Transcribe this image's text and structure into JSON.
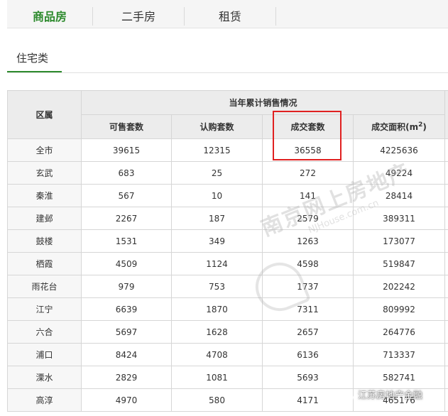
{
  "tabs": {
    "items": [
      {
        "label": "商品房",
        "active": true
      },
      {
        "label": "二手房",
        "active": false
      },
      {
        "label": "租赁",
        "active": false
      }
    ]
  },
  "subtab": {
    "label": "住宅类"
  },
  "table": {
    "district_header": "区属",
    "group_header": "当年累计销售情况",
    "columns": [
      "可售套数",
      "认购套数",
      "成交套数",
      "成交面积(m",
      "2",
      ")"
    ],
    "rows": [
      {
        "district": "全市",
        "available": "39615",
        "subscribed": "12315",
        "deals": "36558",
        "area": "4225636"
      },
      {
        "district": "玄武",
        "available": "683",
        "subscribed": "25",
        "deals": "272",
        "area": "49224"
      },
      {
        "district": "秦淮",
        "available": "567",
        "subscribed": "10",
        "deals": "141",
        "area": "28414"
      },
      {
        "district": "建邺",
        "available": "2267",
        "subscribed": "187",
        "deals": "2579",
        "area": "389311"
      },
      {
        "district": "鼓楼",
        "available": "1531",
        "subscribed": "349",
        "deals": "1263",
        "area": "173077"
      },
      {
        "district": "栖霞",
        "available": "4509",
        "subscribed": "1124",
        "deals": "4598",
        "area": "519847"
      },
      {
        "district": "雨花台",
        "available": "979",
        "subscribed": "753",
        "deals": "1737",
        "area": "202242"
      },
      {
        "district": "江宁",
        "available": "6639",
        "subscribed": "1870",
        "deals": "7311",
        "area": "809992"
      },
      {
        "district": "六合",
        "available": "5697",
        "subscribed": "1628",
        "deals": "2657",
        "area": "264776"
      },
      {
        "district": "浦口",
        "available": "8424",
        "subscribed": "4708",
        "deals": "6136",
        "area": "713337"
      },
      {
        "district": "溧水",
        "available": "2829",
        "subscribed": "1081",
        "deals": "5693",
        "area": "582741"
      },
      {
        "district": "高淳",
        "available": "4970",
        "subscribed": "580",
        "deals": "4171",
        "area": "465176"
      }
    ]
  },
  "watermark": {
    "main": "南京网上房地产",
    "sub": "NJHouse.com.cn",
    "logo_caption": "创造不断"
  },
  "account": {
    "name": "江苏房地产金融",
    "icon": "wechat-icon"
  },
  "colors": {
    "accent": "#2d8a2d",
    "highlight": "#e02020",
    "header_bg": "#ececec"
  }
}
